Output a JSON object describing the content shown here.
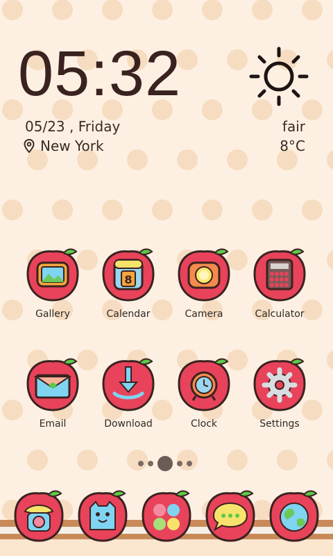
{
  "clock": {
    "time": "05:32"
  },
  "date": {
    "text": "05/23 , Friday"
  },
  "location": {
    "city": "New York",
    "icon": "location-pin-icon"
  },
  "weather": {
    "condition": "fair",
    "temperature": "8°C",
    "icon": "sun-icon"
  },
  "apps": [
    {
      "label": "Gallery",
      "icon": "gallery-icon"
    },
    {
      "label": "Calendar",
      "icon": "calendar-icon",
      "badge": "8"
    },
    {
      "label": "Camera",
      "icon": "camera-icon"
    },
    {
      "label": "Calculator",
      "icon": "calculator-icon"
    },
    {
      "label": "Email",
      "icon": "email-icon"
    },
    {
      "label": "Download",
      "icon": "download-icon"
    },
    {
      "label": "Clock",
      "icon": "alarm-clock-icon"
    },
    {
      "label": "Settings",
      "icon": "gear-icon"
    }
  ],
  "page_indicator": {
    "total": 5,
    "active": 3
  },
  "dock": [
    {
      "icon": "phone-icon"
    },
    {
      "icon": "contacts-icon"
    },
    {
      "icon": "apps-drawer-icon"
    },
    {
      "icon": "messages-icon"
    },
    {
      "icon": "browser-globe-icon"
    }
  ],
  "colors": {
    "background": "#fdf0e2",
    "polka_dot": "#f6dcc0",
    "apple_red": "#e8435a",
    "outline": "#3a2220",
    "leaf_green": "#5cc94a",
    "shelf_brown": "#c98a5a"
  }
}
